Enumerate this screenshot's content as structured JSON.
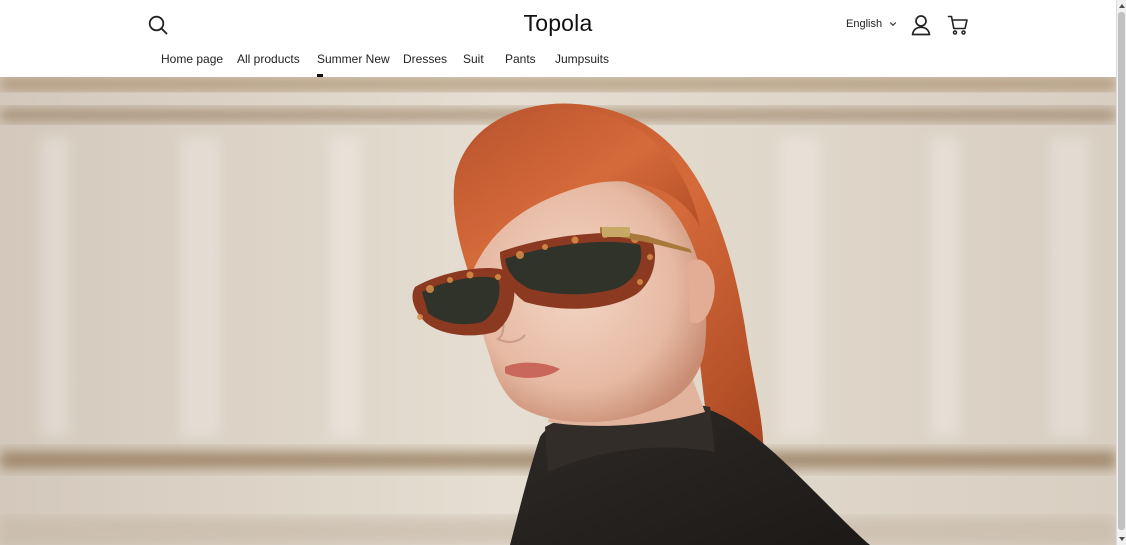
{
  "header": {
    "brand": "Topola",
    "language": "English"
  },
  "nav": {
    "items": [
      "Home page",
      "All products",
      "Summer New",
      "Dresses",
      "Suit",
      "Pants",
      "Jumpsuits"
    ],
    "active": "Summer New"
  },
  "icons": {
    "search": "search-icon",
    "user": "user-icon",
    "cart": "cart-icon",
    "language_chevron": "chevron-down-icon"
  },
  "colors": {
    "text": "#222222",
    "background": "#ffffff",
    "hair": "#c9542a",
    "sweater": "#262220",
    "backdrop": "#d9cfc2"
  }
}
